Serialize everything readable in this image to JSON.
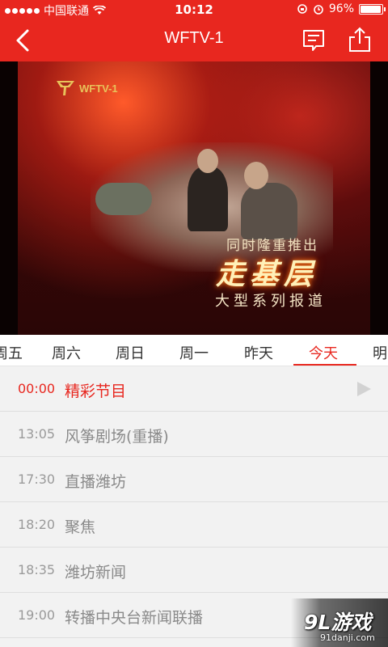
{
  "status_bar": {
    "carrier": "中国联通",
    "time": "10:12",
    "battery": "96%",
    "battery_level": 0.96
  },
  "header": {
    "title": "WFTV-1",
    "icons": [
      "back-icon",
      "comment-icon",
      "share-icon"
    ]
  },
  "video": {
    "logo_text": "WFTV-1",
    "caption_line1": "同时隆重推出",
    "caption_line2": "走基层",
    "caption_line3": "大型系列报道"
  },
  "day_tabs": {
    "items": [
      "周五",
      "周六",
      "周日",
      "周一",
      "昨天",
      "今天",
      "明"
    ],
    "active": "今天"
  },
  "schedule": [
    {
      "time": "00:00",
      "program": "精彩节目",
      "current": true
    },
    {
      "time": "13:05",
      "program": "风筝剧场(重播)"
    },
    {
      "time": "17:30",
      "program": "直播潍坊"
    },
    {
      "time": "18:20",
      "program": "聚焦"
    },
    {
      "time": "18:35",
      "program": "潍坊新闻"
    },
    {
      "time": "19:00",
      "program": "转播中央台新闻联播"
    }
  ],
  "watermark": {
    "main": "9L游戏",
    "sub": "91danji.com"
  },
  "colors": {
    "accent": "#e8271f",
    "background": "#f2f2f2",
    "muted_text": "#9a9a9a"
  }
}
